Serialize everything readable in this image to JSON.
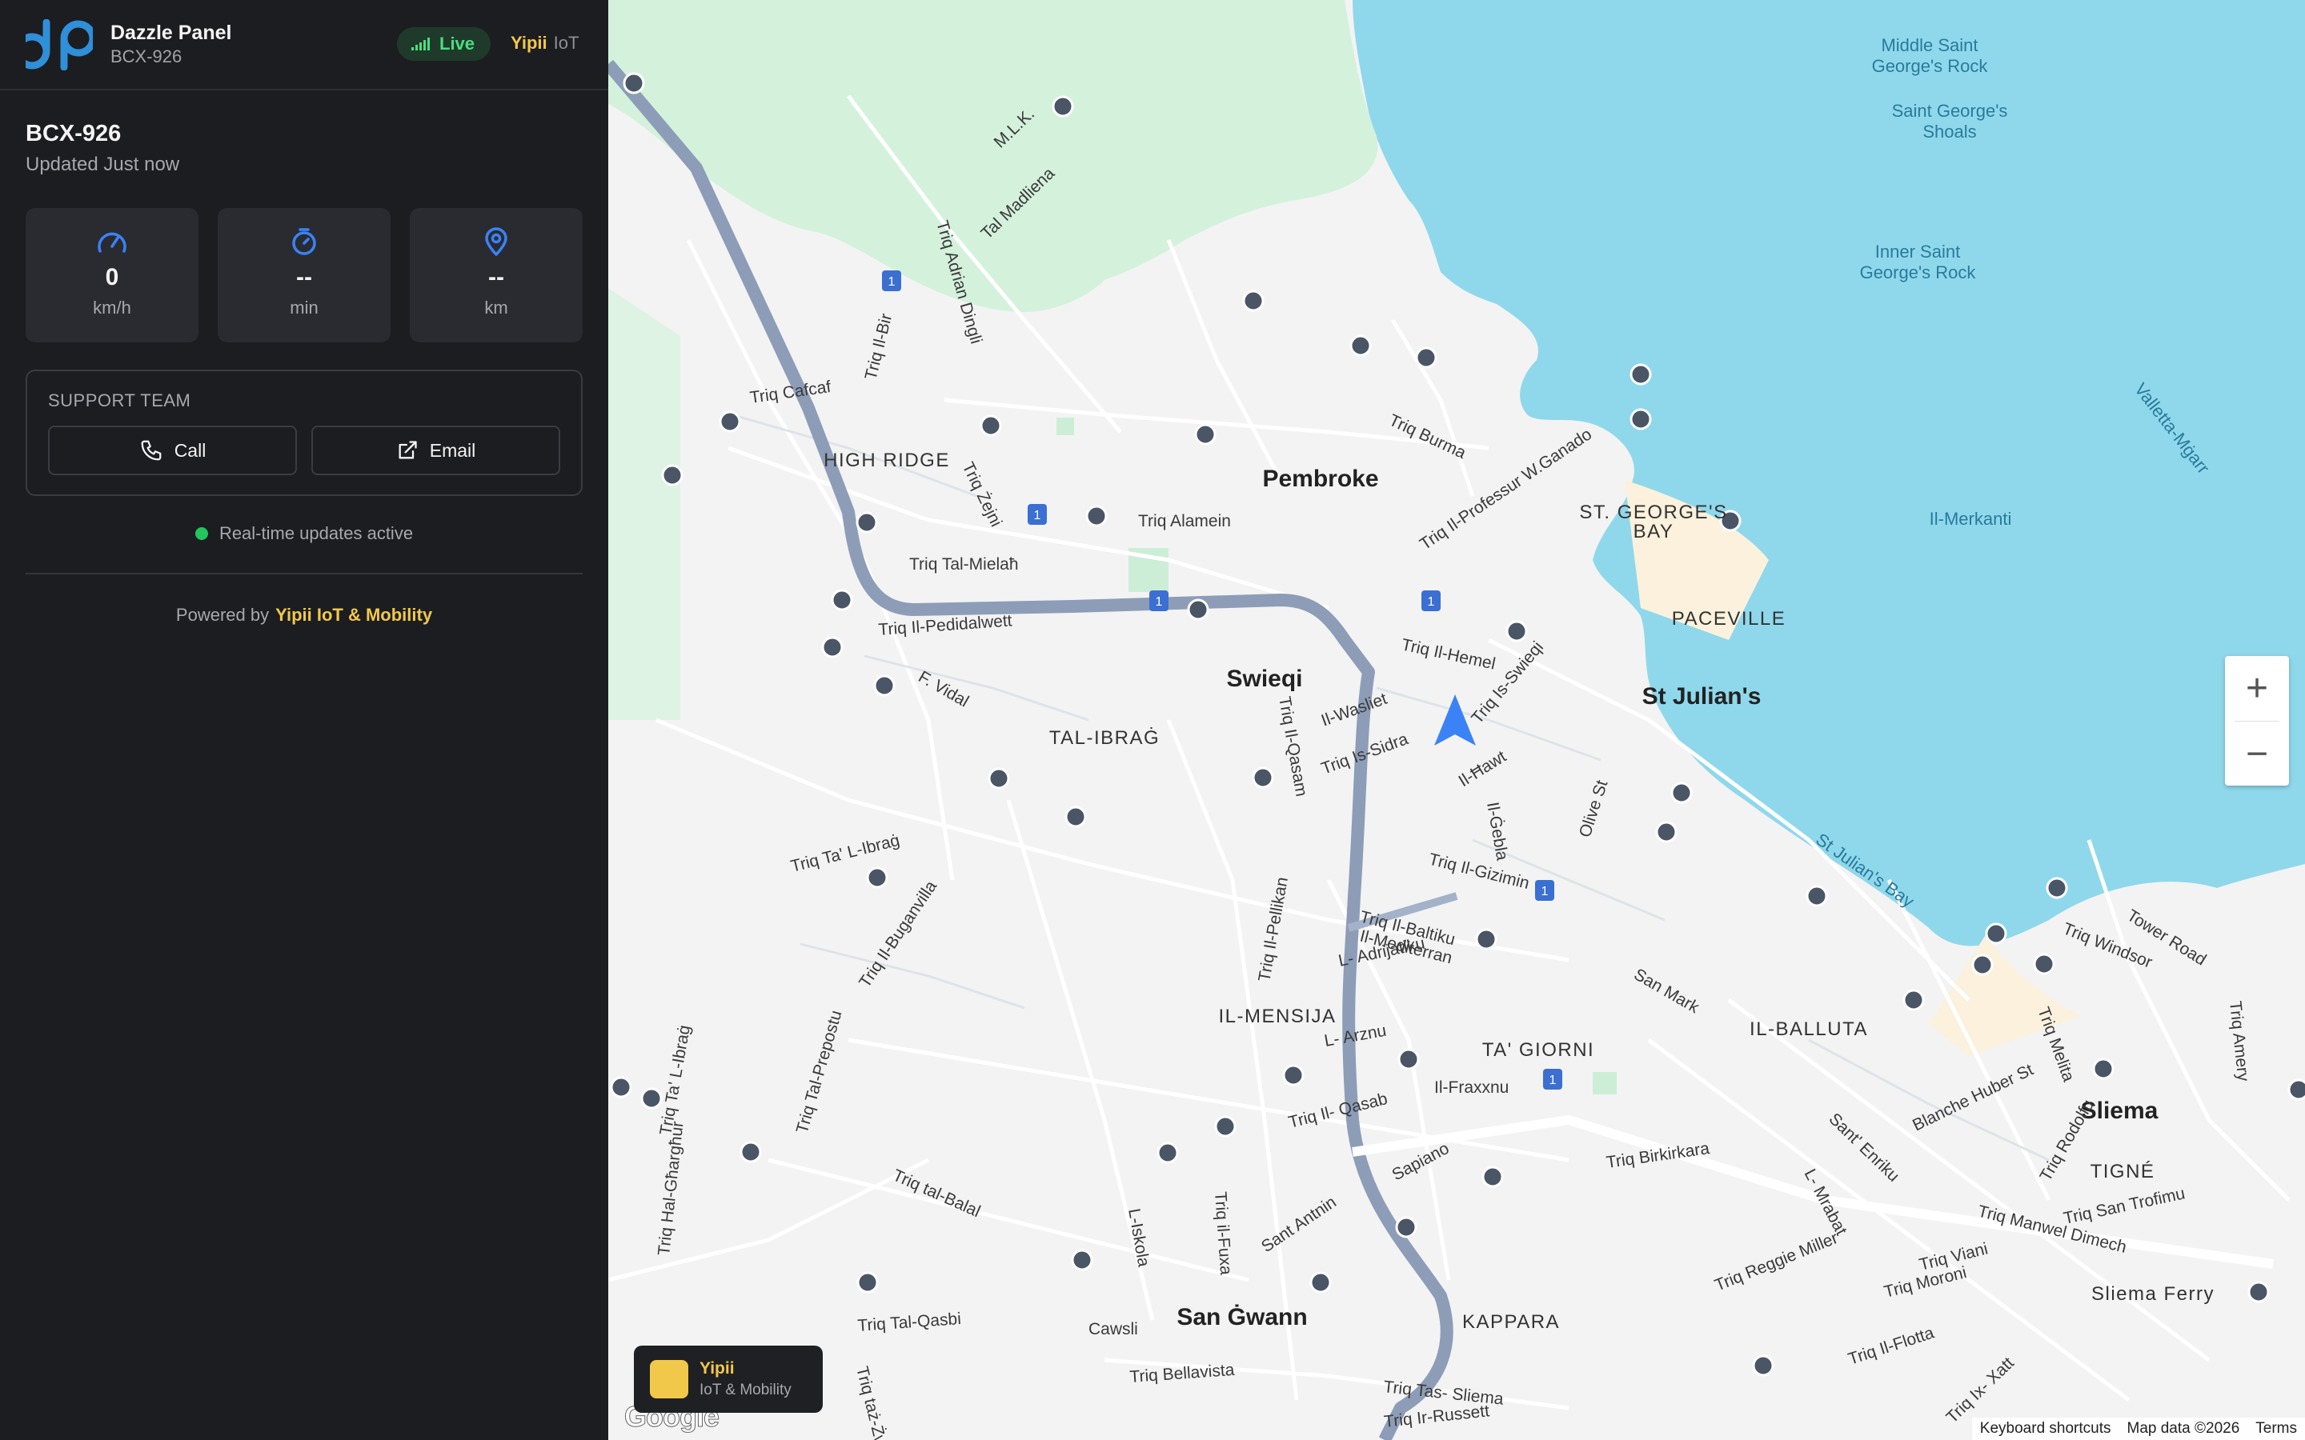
{
  "header": {
    "app_title": "Dazzle Panel",
    "app_subtitle": "BCX-926",
    "live_label": "Live",
    "brand_name": "Yipii",
    "brand_suffix": "IoT"
  },
  "vehicle": {
    "id": "BCX-926",
    "updated": "Updated Just now"
  },
  "stats": [
    {
      "icon": "speedometer-icon",
      "value": "0",
      "unit": "km/h"
    },
    {
      "icon": "timer-icon",
      "value": "--",
      "unit": "min"
    },
    {
      "icon": "location-pin-icon",
      "value": "--",
      "unit": "km"
    }
  ],
  "support": {
    "title": "SUPPORT TEAM",
    "call_label": "Call",
    "email_label": "Email"
  },
  "status": {
    "realtime_text": "Real-time updates active"
  },
  "footer": {
    "powered_prefix": "Powered by",
    "powered_brand": "Yipii IoT & Mobility"
  },
  "map": {
    "zoom_in": "+",
    "zoom_out": "−",
    "google": "Google",
    "keyboard_shortcuts": "Keyboard shortcuts",
    "map_data": "Map data ©2026",
    "terms": "Terms",
    "badge_title": "Yipii",
    "badge_subtitle": "IoT & Mobility",
    "labels": {
      "middle_rock": "Middle Saint",
      "middle_rock2": "George's Rock",
      "shoals": "Saint George's",
      "shoals2": "Shoals",
      "inner_rock": "Inner Saint",
      "inner_rock2": "George's Rock",
      "valletta_mgarr": "Valletta-Mġarr",
      "il_merkanti": "Il-Merkanti",
      "pembroke": "Pembroke",
      "high_ridge": "HIGH RIDGE",
      "st_georges_bay": "ST. GEORGE'S",
      "st_georges_bay2": "BAY",
      "paceville": "PACEVILLE",
      "st_julians": "St Julian's",
      "swieqi": "Swieqi",
      "tal_ibrag": "TAL-IBRAĠ",
      "st_julians_bay": "St Julian's Bay",
      "il_mensija": "IL-MENSIJA",
      "ta_giorni": "TA' GIORNI",
      "il_balluta": "IL-BALLUTA",
      "sliema": "Sliema",
      "tigne": "TIGNÉ",
      "san_gwann": "San Ġwann",
      "kappara": "KAPPARA",
      "sliema_ferry": "Sliema Ferry",
      "triq_alamein": "Triq Alamein",
      "triq_burma": "Triq Burma",
      "triq_ganado": "Triq Il-Professur W.Ganado",
      "triq_cafcaf": "Triq Cafcaf",
      "triq_tal_mielah": "Triq Tal-Mielaħ",
      "triq_pedidalwett": "Triq Il-Pedidalwett",
      "triq_birkirkara": "Triq Birkirkara",
      "triq_manwel_dimech": "Triq Manwel Dimech",
      "triq_bellavista": "Triq Bellavista",
      "triq_tas_sliema": "Triq Tas- Sliema",
      "triq_tal_balal": "Triq tal-Balal",
      "triq_qasam": "Triq Il-Qasam",
      "triq_pellikan": "Triq Il-Pellikan",
      "triq_il_hemel": "Triq Il-Hemel",
      "tower_road": "Tower Road",
      "triq_windsor": "Triq Windsor",
      "san_mark": "San Mark",
      "triq_gizimin": "Triq Il-Gizimin",
      "triq_tal_qasbi": "Triq Tal-Qasbi",
      "cawsli": "Cawsli",
      "l_iskola": "L-Iskola",
      "triq_il_fuxa": "Triq il-Fuxa",
      "sapiano": "Sapiano",
      "sant_antnin": "Sant Antnin",
      "triq_il_qasab": "Triq Il- Qasab",
      "il_fraxxnu": "Il-Fraxxnu",
      "triq_il_flotta": "Triq Il-Flotta",
      "triq_ix_xatt": "Triq Ix- Xatt",
      "triq_ir_russett": "Triq Ir-Russett",
      "mlk": "M.L.K.",
      "tal_madliena": "Tal Madliena",
      "triq_adrian_dingli": "Triq Adrian Dingli",
      "triq_il_bir": "Triq Il-Bir",
      "triq_zejni": "Triq Żejni",
      "f_vidal": "F. Vidal",
      "triq_ta_librag": "Triq Ta' L-Ibraġ",
      "triq_il_buganvilla": "Triq Il-Buganvilla",
      "triq_tal_prepostu": "Triq Tal-Prepostu",
      "il_wasliet": "Il-Wasliet",
      "triq_is_sidra": "Triq Is-Sidra",
      "il_hawt": "Il-Ħawt",
      "il_gebla": "Il-Ġebla",
      "triq_is_swieqi": "Triq Is-Swieqi",
      "olive_st": "Olive St",
      "triq_il_baltiku": "Triq Il-Baltiku",
      "il_mediterran": "Il-Mediterran",
      "l_adrijatiku": "L- Adrijatiku",
      "l_arznu": "L- Arznu",
      "triq_reggie_miller": "Triq Reggie Miller",
      "triq_viani": "Triq Viani",
      "triq_moroni": "Triq Moroni",
      "blanche_huber": "Blanche Huber St",
      "sant_enriku": "Sant' Enriku",
      "l_mrabat": "L- Mrabat",
      "triq_melita": "Triq Melita",
      "triq_rodolfu": "Triq Rodolfu",
      "triq_san_trofimu": "Triq San Trofimu",
      "triq_amery": "Triq Amery",
      "triq_tal_ibrag2": "Triq Ta' L-Ibraġ",
      "triq_hal_gharghur": "Triq Hal-Għargħur",
      "triq_taz_zwejt": "Triq taż-Żwejt",
      "triq_birkirkara2": "Triq Birkirkara",
      "route_no": "1"
    }
  },
  "colors": {
    "accent": "#f2c84b",
    "live_green": "#4ade80",
    "icon_blue": "#3b82f6",
    "sea": "#8fd8ec",
    "park": "#d4f1dc",
    "highway": "#8d9db7"
  }
}
